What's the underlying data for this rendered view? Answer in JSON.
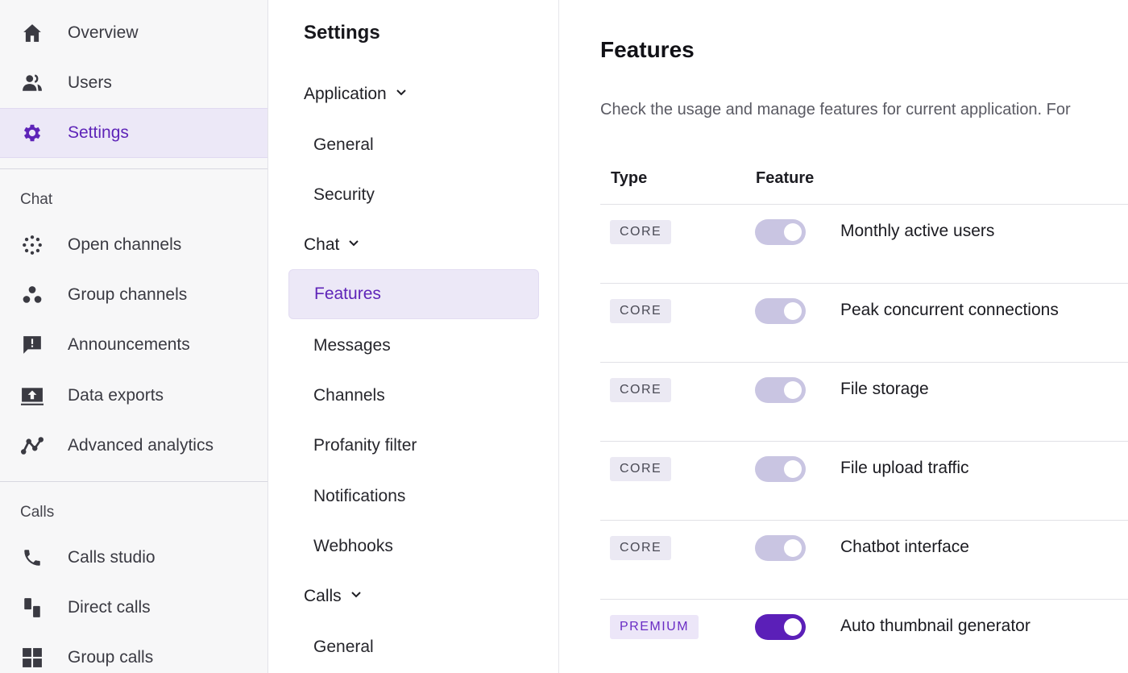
{
  "sidebar": {
    "top_items": [
      {
        "label": "Overview",
        "icon": "home-icon"
      },
      {
        "label": "Users",
        "icon": "users-icon"
      },
      {
        "label": "Settings",
        "icon": "gear-icon",
        "active": true
      }
    ],
    "chat_section": "Chat",
    "chat_items": [
      {
        "label": "Open channels",
        "icon": "open-channels-icon"
      },
      {
        "label": "Group channels",
        "icon": "group-channels-icon"
      },
      {
        "label": "Announcements",
        "icon": "announcement-icon"
      },
      {
        "label": "Data exports",
        "icon": "data-export-icon"
      },
      {
        "label": "Advanced analytics",
        "icon": "analytics-icon"
      }
    ],
    "calls_section": "Calls",
    "calls_items": [
      {
        "label": "Calls studio",
        "icon": "phone-icon"
      },
      {
        "label": "Direct calls",
        "icon": "direct-calls-icon"
      },
      {
        "label": "Group calls",
        "icon": "grid-icon"
      }
    ]
  },
  "settings_nav": {
    "title": "Settings",
    "groups": [
      {
        "label": "Application",
        "items": [
          "General",
          "Security"
        ]
      },
      {
        "label": "Chat",
        "items": [
          "Features",
          "Messages",
          "Channels",
          "Profanity filter",
          "Notifications",
          "Webhooks"
        ]
      },
      {
        "label": "Calls",
        "items": [
          "General"
        ]
      }
    ],
    "active_item": "Features"
  },
  "main": {
    "title": "Features",
    "description": "Check the usage and manage features for current application. For",
    "columns": {
      "type": "Type",
      "feature": "Feature"
    },
    "rows": [
      {
        "type": "CORE",
        "feature": "Monthly active users",
        "enabled": true,
        "premium": false
      },
      {
        "type": "CORE",
        "feature": "Peak concurrent connections",
        "enabled": true,
        "premium": false
      },
      {
        "type": "CORE",
        "feature": "File storage",
        "enabled": true,
        "premium": false
      },
      {
        "type": "CORE",
        "feature": "File upload traffic",
        "enabled": true,
        "premium": false
      },
      {
        "type": "CORE",
        "feature": "Chatbot interface",
        "enabled": true,
        "premium": false
      },
      {
        "type": "PREMIUM",
        "feature": "Auto thumbnail generator",
        "enabled": true,
        "premium": true
      }
    ]
  },
  "colors": {
    "accent": "#5e24b8",
    "active_bg": "#ece8f7",
    "toggle_core": "#c9c5e2",
    "toggle_on": "#5b1fb8",
    "sidebar_bg": "#f7f7f8"
  }
}
